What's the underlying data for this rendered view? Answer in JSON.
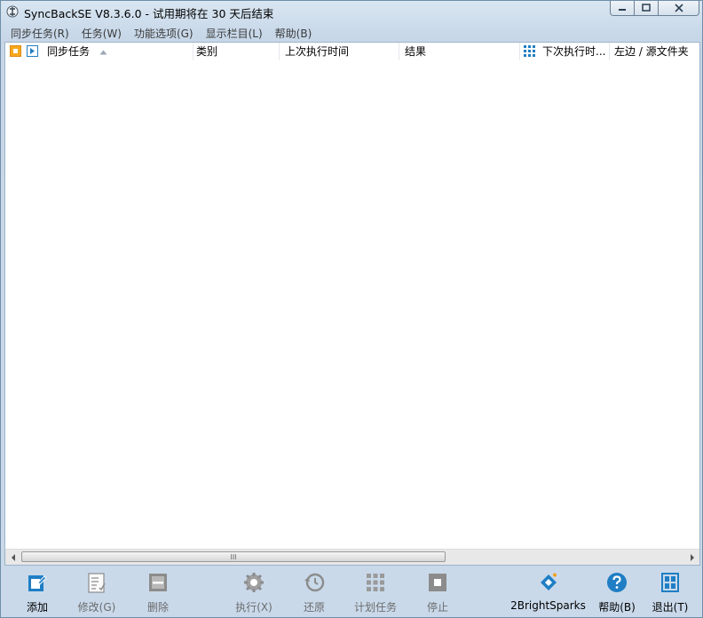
{
  "window": {
    "title": "SyncBackSE V8.3.6.0 - 试用期将在 30 天后结束",
    "controls": {
      "minimize": "—",
      "maximize": "□",
      "close": "✕"
    }
  },
  "menu": [
    {
      "label": "同步任务(R)"
    },
    {
      "label": "任务(W)"
    },
    {
      "label": "功能选项(G)"
    },
    {
      "label": "显示栏目(L)"
    },
    {
      "label": "帮助(B)"
    }
  ],
  "columns": {
    "name": "同步任务",
    "type": "类别",
    "last_run": "上次执行时间",
    "result": "结果",
    "next_run": "下次执行时...",
    "left_source": "左边 / 源文件夹"
  },
  "scrollbar": {
    "thumb_grip": "III"
  },
  "toolbar": {
    "add": "添加",
    "modify": "修改(G)",
    "delete": "删除",
    "run": "执行(X)",
    "restore": "还原",
    "schedule": "计划任务",
    "stop": "停止",
    "brand": "2BrightSparks",
    "help": "帮助(B)",
    "exit": "退出(T)"
  },
  "colors": {
    "accent_blue": "#1f7ec4",
    "orange": "#f0a020",
    "disabled_gray": "#8c8c8c"
  }
}
